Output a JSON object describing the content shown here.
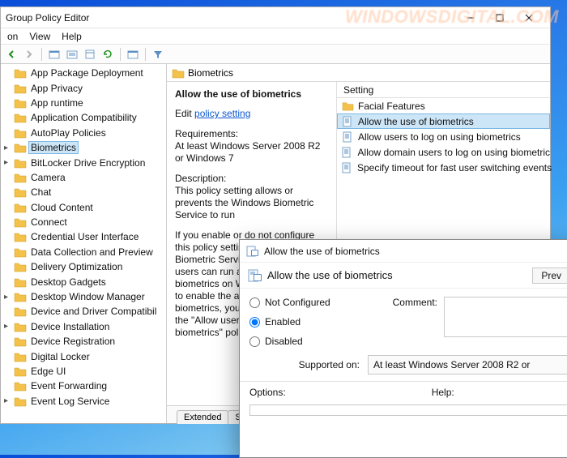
{
  "watermark": "WINDOWSDIGITAL.COM",
  "window": {
    "title": "Group Policy Editor",
    "menus": [
      "on",
      "View",
      "Help"
    ]
  },
  "tree_items": [
    {
      "label": "App Package Deployment",
      "exp": false
    },
    {
      "label": "App Privacy",
      "exp": false
    },
    {
      "label": "App runtime",
      "exp": false
    },
    {
      "label": "Application Compatibility",
      "exp": false
    },
    {
      "label": "AutoPlay Policies",
      "exp": false
    },
    {
      "label": "Biometrics",
      "exp": true,
      "selected": true
    },
    {
      "label": "BitLocker Drive Encryption",
      "exp": true
    },
    {
      "label": "Camera",
      "exp": false
    },
    {
      "label": "Chat",
      "exp": false
    },
    {
      "label": "Cloud Content",
      "exp": false
    },
    {
      "label": "Connect",
      "exp": false
    },
    {
      "label": "Credential User Interface",
      "exp": false
    },
    {
      "label": "Data Collection and Preview",
      "exp": false
    },
    {
      "label": "Delivery Optimization",
      "exp": false
    },
    {
      "label": "Desktop Gadgets",
      "exp": false
    },
    {
      "label": "Desktop Window Manager",
      "exp": true
    },
    {
      "label": "Device and Driver Compatibil",
      "exp": false
    },
    {
      "label": "Device Installation",
      "exp": true
    },
    {
      "label": "Device Registration",
      "exp": false
    },
    {
      "label": "Digital Locker",
      "exp": false
    },
    {
      "label": "Edge UI",
      "exp": false
    },
    {
      "label": "Event Forwarding",
      "exp": false
    },
    {
      "label": "Event Log Service",
      "exp": true
    }
  ],
  "rightpane": {
    "header": "Biometrics",
    "help_title": "Allow the use of biometrics",
    "edit_prefix": "Edit",
    "edit_link": "policy setting ",
    "req_label": "Requirements:",
    "req_value": "At least Windows Server 2008 R2 or Windows 7",
    "desc_label": "Description:",
    "desc_text": "This policy setting allows or prevents the Windows Biometric Service to run",
    "more_text": "If you enable or do not configure this policy setting, the Windows Biometric Service is available, and users can run applications that use biometrics on Windows. If you want to enable the ability to log on with biometrics, you must also configure the \"Allow users to log on using biometrics\" policy setting.",
    "list_header": "Setting",
    "list": [
      {
        "icon": "folder",
        "label": "Facial Features"
      },
      {
        "icon": "policy",
        "label": "Allow the use of biometrics",
        "selected": true
      },
      {
        "icon": "policy",
        "label": "Allow users to log on using biometrics"
      },
      {
        "icon": "policy",
        "label": "Allow domain users to log on using biometric"
      },
      {
        "icon": "policy",
        "label": "Specify timeout for fast user switching events"
      }
    ],
    "tabs": [
      "Extended",
      "S"
    ]
  },
  "dialog": {
    "title": "Allow the use of biometrics",
    "heading": "Allow the use of biometrics",
    "prev_btn": "Prev",
    "radios": {
      "not_configured": "Not Configured",
      "enabled": "Enabled",
      "disabled": "Disabled",
      "selected": "enabled"
    },
    "comment_label": "Comment:",
    "supported_label": "Supported on:",
    "supported_value": "At least Windows Server 2008 R2 or",
    "options_label": "Options:",
    "help_label": "Help:"
  }
}
